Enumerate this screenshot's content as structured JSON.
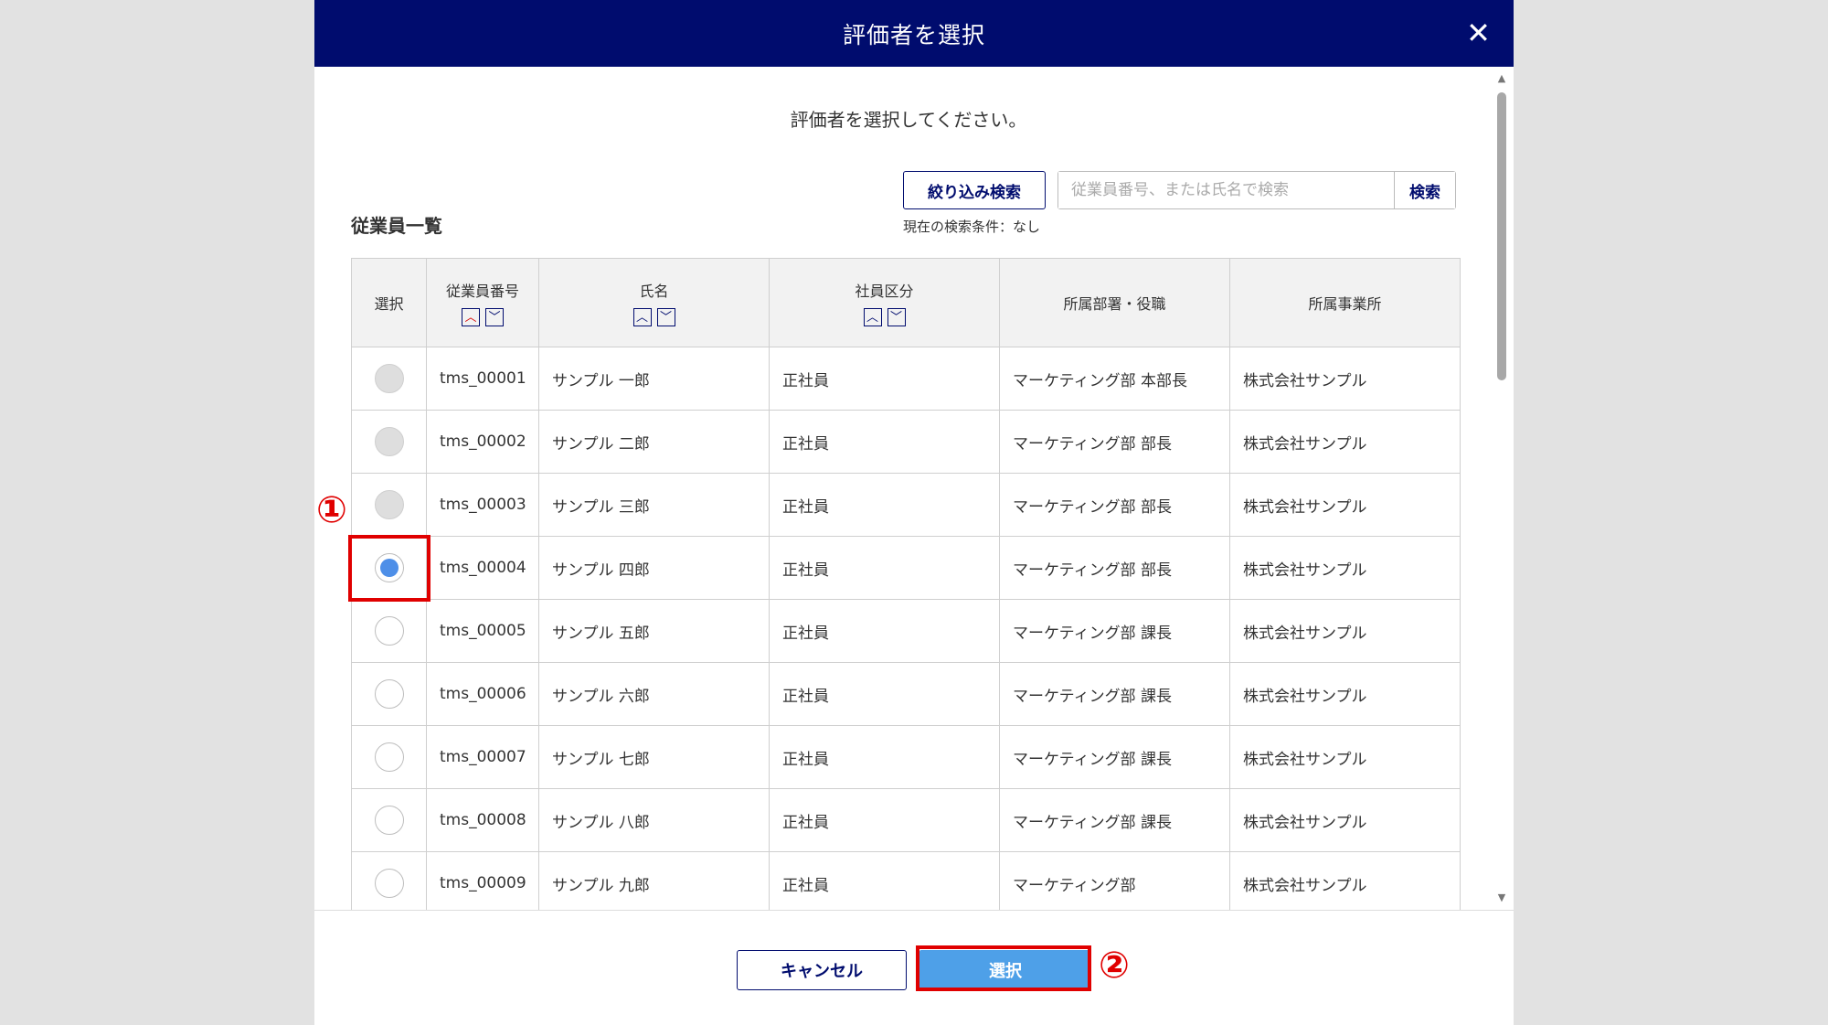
{
  "dialog": {
    "title": "評価者を選択",
    "instruction": "評価者を選択してください。",
    "list_title": "従業員一覧",
    "filter_button": "絞り込み検索",
    "search_placeholder": "従業員番号、または氏名で検索",
    "search_button": "検索",
    "search_condition": "現在の検索条件：なし",
    "columns": [
      "選択",
      "従業員番号",
      "氏名",
      "社員区分",
      "所属部署・役職",
      "所属事業所"
    ],
    "sort_up_icon": "chevron-up-icon",
    "sort_down_icon": "chevron-down-icon",
    "rows": [
      {
        "id": "tms_00001",
        "name": "サンプル 一郎",
        "type": "正社員",
        "dept": "マーケティング部 本部長",
        "office": "株式会社サンプル",
        "state": "disabled"
      },
      {
        "id": "tms_00002",
        "name": "サンプル 二郎",
        "type": "正社員",
        "dept": "マーケティング部 部長",
        "office": "株式会社サンプル",
        "state": "disabled"
      },
      {
        "id": "tms_00003",
        "name": "サンプル 三郎",
        "type": "正社員",
        "dept": "マーケティング部 部長",
        "office": "株式会社サンプル",
        "state": "disabled"
      },
      {
        "id": "tms_00004",
        "name": "サンプル 四郎",
        "type": "正社員",
        "dept": "マーケティング部 部長",
        "office": "株式会社サンプル",
        "state": "checked"
      },
      {
        "id": "tms_00005",
        "name": "サンプル 五郎",
        "type": "正社員",
        "dept": "マーケティング部 課長",
        "office": "株式会社サンプル",
        "state": "unchecked"
      },
      {
        "id": "tms_00006",
        "name": "サンプル 六郎",
        "type": "正社員",
        "dept": "マーケティング部 課長",
        "office": "株式会社サンプル",
        "state": "unchecked"
      },
      {
        "id": "tms_00007",
        "name": "サンプル 七郎",
        "type": "正社員",
        "dept": "マーケティング部 課長",
        "office": "株式会社サンプル",
        "state": "unchecked"
      },
      {
        "id": "tms_00008",
        "name": "サンプル 八郎",
        "type": "正社員",
        "dept": "マーケティング部 課長",
        "office": "株式会社サンプル",
        "state": "unchecked"
      },
      {
        "id": "tms_00009",
        "name": "サンプル 九郎",
        "type": "正社員",
        "dept": "マーケティング部",
        "office": "株式会社サンプル",
        "state": "unchecked"
      }
    ],
    "cancel_button": "キャンセル",
    "select_button": "選択"
  },
  "annotations": {
    "step1": "①",
    "step2": "②",
    "highlight_color": "#e00000"
  },
  "colors": {
    "header_bg": "#000c6e",
    "primary_button": "#4ea0e8",
    "radio_checked": "#4e8fe8"
  }
}
